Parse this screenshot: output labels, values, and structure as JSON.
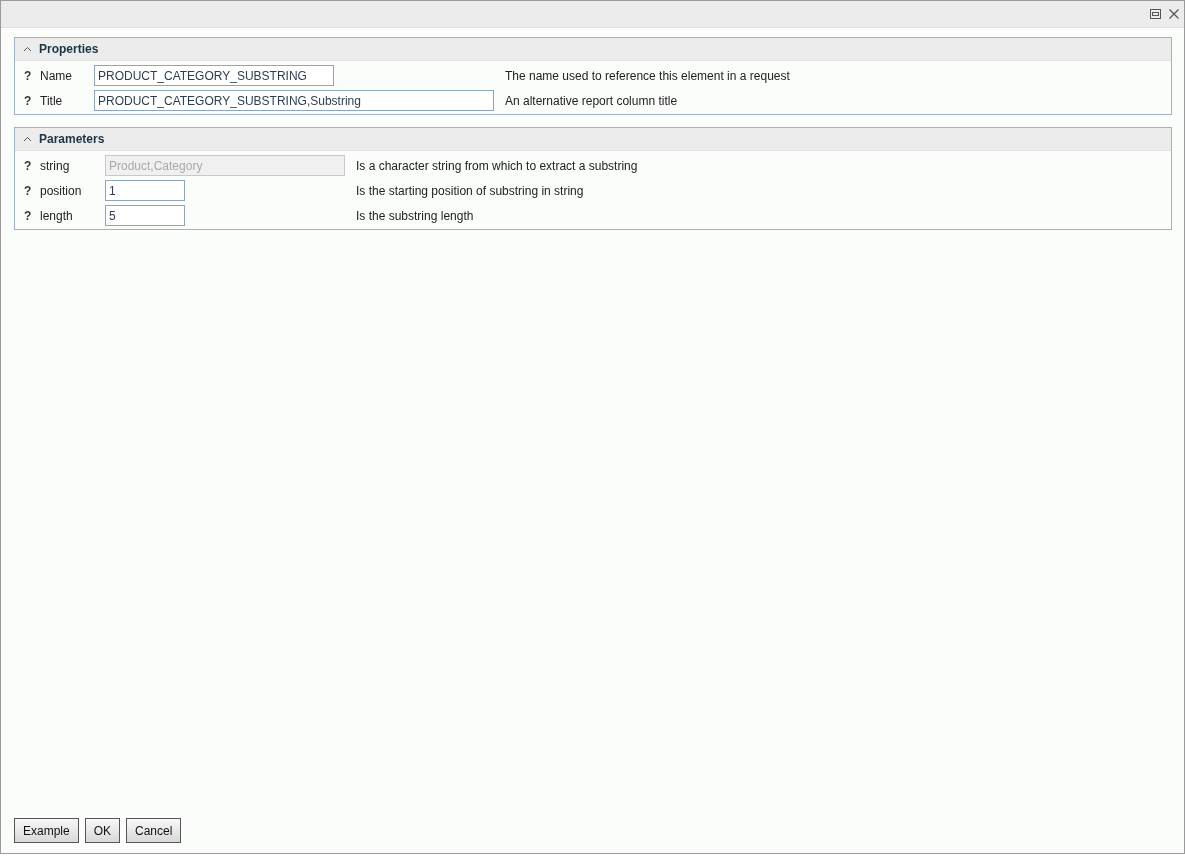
{
  "window": {
    "controls": [
      {
        "kind": "restore"
      },
      {
        "kind": "close"
      }
    ]
  },
  "sections": [
    {
      "title": "Properties",
      "expanded": true,
      "rows": [
        {
          "help": "?",
          "label": "Name",
          "value": "PRODUCT_CATEGORY_SUBSTRING",
          "disabled": false,
          "description": "The name used to reference this element in a request"
        },
        {
          "help": "?",
          "label": "Title",
          "value": "PRODUCT_CATEGORY_SUBSTRING,Substring",
          "disabled": false,
          "description": "An alternative report column title"
        }
      ]
    },
    {
      "title": "Parameters",
      "expanded": true,
      "rows": [
        {
          "help": "?",
          "label": "string",
          "value": "Product,Category",
          "disabled": true,
          "description": "Is a character string from which to extract a substring"
        },
        {
          "help": "?",
          "label": "position",
          "value": "1",
          "disabled": false,
          "description": "Is the starting position of substring in string"
        },
        {
          "help": "?",
          "label": "length",
          "value": "5",
          "disabled": false,
          "description": "Is the substring length"
        }
      ]
    }
  ],
  "buttons": [
    "Example",
    "OK",
    "Cancel"
  ]
}
